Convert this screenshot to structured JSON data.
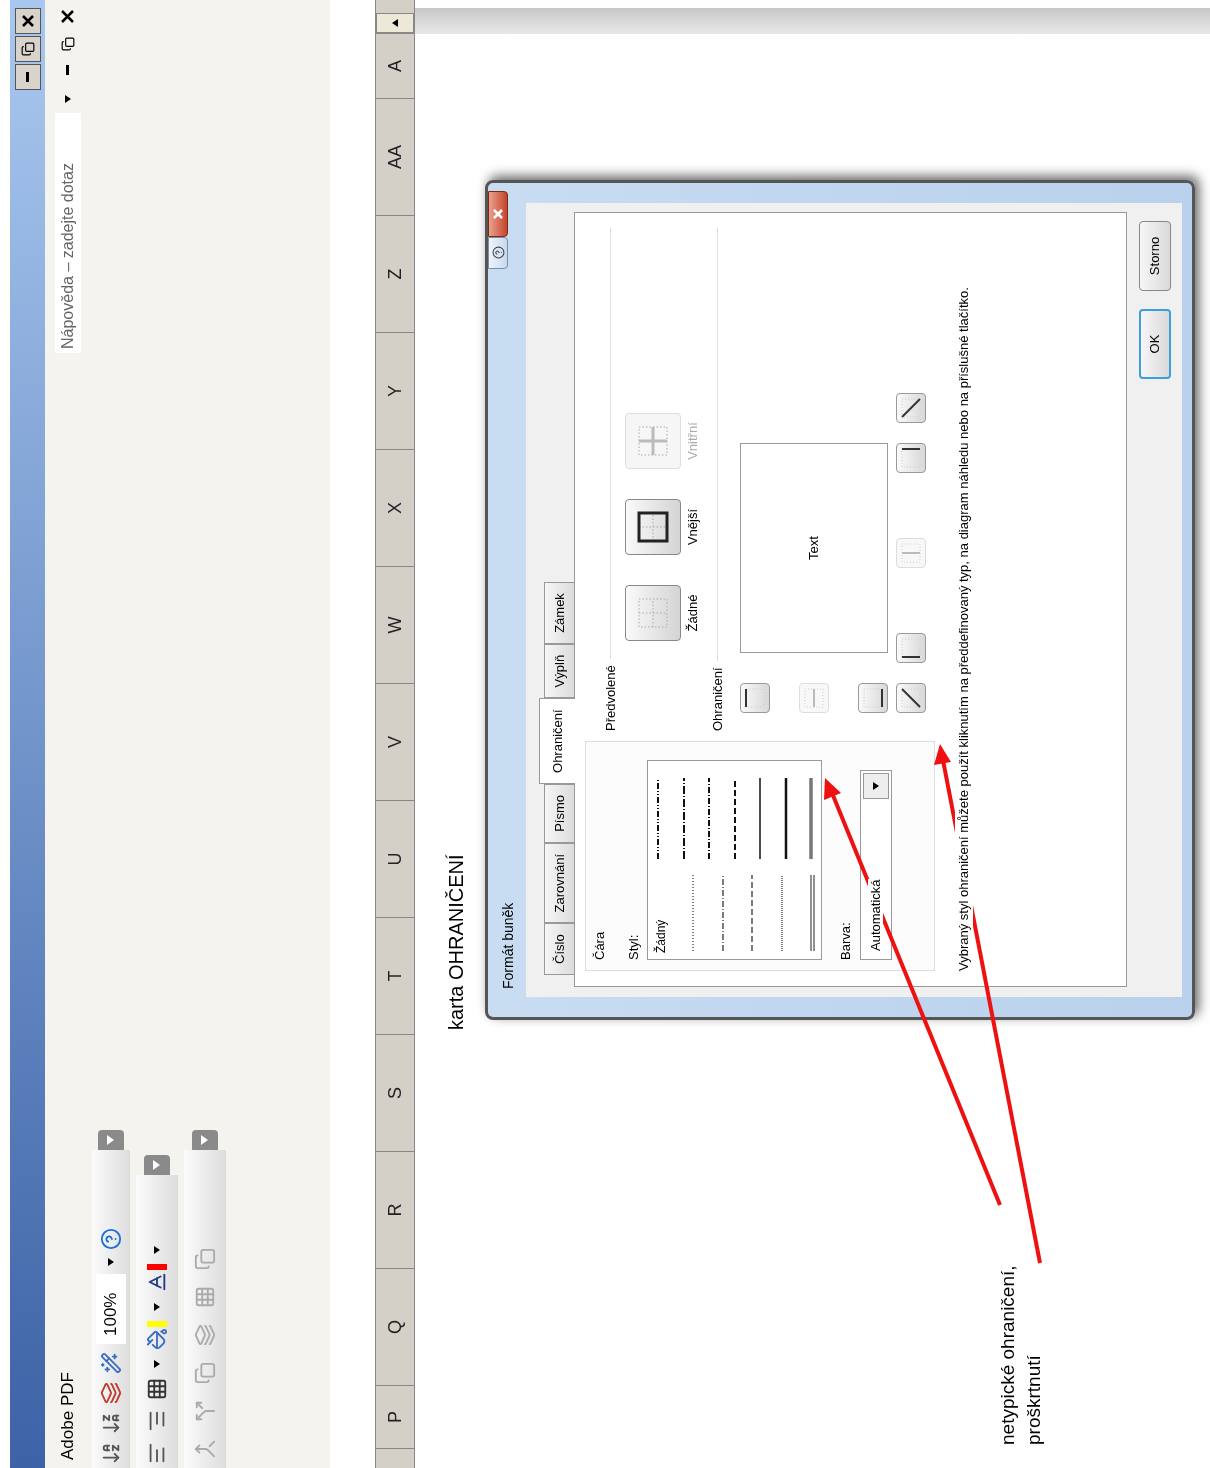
{
  "menu_bar": {
    "item": "Adobe PDF",
    "help_search": {
      "placeholder": "Nápověda – zadejte dotaz"
    }
  },
  "toolbar": {
    "zoom": "100%"
  },
  "columns": [
    "P",
    "Q",
    "R",
    "S",
    "T",
    "U",
    "V",
    "W",
    "X",
    "Y",
    "Z",
    "AA",
    "A"
  ],
  "caption": "karta OHRANIČENÍ",
  "dialog": {
    "title": "Formát buněk",
    "tabs": [
      {
        "label": "Číslo",
        "selected": false
      },
      {
        "label": "Zarovnání",
        "selected": false
      },
      {
        "label": "Písmo",
        "selected": false
      },
      {
        "label": "Ohraničení",
        "selected": true
      },
      {
        "label": "Výplň",
        "selected": false
      },
      {
        "label": "Zámek",
        "selected": false
      }
    ],
    "line": {
      "label": "Čára",
      "style_label": "Styl:",
      "none_style": "Žádný",
      "color_label": "Barva:",
      "color_value": "Automatická"
    },
    "presets": {
      "label": "Předvolené",
      "items": [
        {
          "label": "Žádné",
          "kind": "none",
          "disabled": false
        },
        {
          "label": "Vnější",
          "kind": "outline",
          "disabled": false
        },
        {
          "label": "Vnitřní",
          "kind": "inside",
          "disabled": true
        }
      ]
    },
    "border": {
      "label": "Ohraničení",
      "preview_text": "Text",
      "side_buttons": [
        {
          "kind": "top",
          "disabled": false
        },
        {
          "kind": "hmid",
          "disabled": true
        },
        {
          "kind": "bottom",
          "disabled": false
        }
      ],
      "bottom_buttons": [
        {
          "kind": "diagup",
          "disabled": false
        },
        {
          "kind": "left",
          "disabled": false
        },
        {
          "kind": "vmid",
          "disabled": true
        },
        {
          "kind": "right",
          "disabled": false
        },
        {
          "kind": "diagdown",
          "disabled": false
        }
      ]
    },
    "hint": "Vybraný styl ohraničení můžete použít kliknutím na předdefinovaný typ, na diagram náhledu nebo na příslušné tlačítko.",
    "buttons": [
      {
        "label": "OK",
        "default": true
      },
      {
        "label": "Storno",
        "default": false
      }
    ]
  },
  "annotation": "netypické ohraničení,\nproškrtnutí"
}
